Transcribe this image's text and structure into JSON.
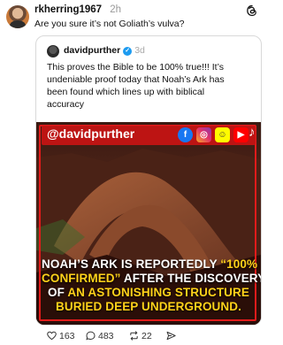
{
  "post": {
    "username": "rkherring1967",
    "timestamp": "2h",
    "text": "Are you sure it’s not Goliath’s vulva?"
  },
  "quote": {
    "username": "davidpurther",
    "timestamp": "3d",
    "body_lines": [
      "This proves the Bible to be 100% true!!! It’s",
      "undeniable proof today that Noah’s Ark has",
      "been found which lines up with biblical",
      "accuracy"
    ],
    "media": {
      "handle": "@davidpurther",
      "headline_lines": [
        {
          "parts": [
            {
              "t": "NOAH’S ARK IS REPORTEDLY ",
              "y": false
            },
            {
              "t": "“100%",
              "y": true
            }
          ]
        },
        {
          "parts": [
            {
              "t": "CONFIRMED”",
              "y": true
            },
            {
              "t": " AFTER THE DISCOVERY",
              "y": false
            }
          ]
        },
        {
          "parts": [
            {
              "t": "OF ",
              "y": false
            },
            {
              "t": "AN ASTONISHING STRUCTURE",
              "y": true
            }
          ]
        },
        {
          "parts": [
            {
              "t": "BURIED DEEP UNDERGROUND.",
              "y": true
            }
          ]
        }
      ]
    }
  },
  "actions": {
    "likes": "163",
    "replies": "483",
    "reposts": "22"
  },
  "colors": {
    "accent_red": "#e11b1b",
    "headline_yellow": "#ffd21a",
    "verified_blue": "#1d9bf0"
  }
}
